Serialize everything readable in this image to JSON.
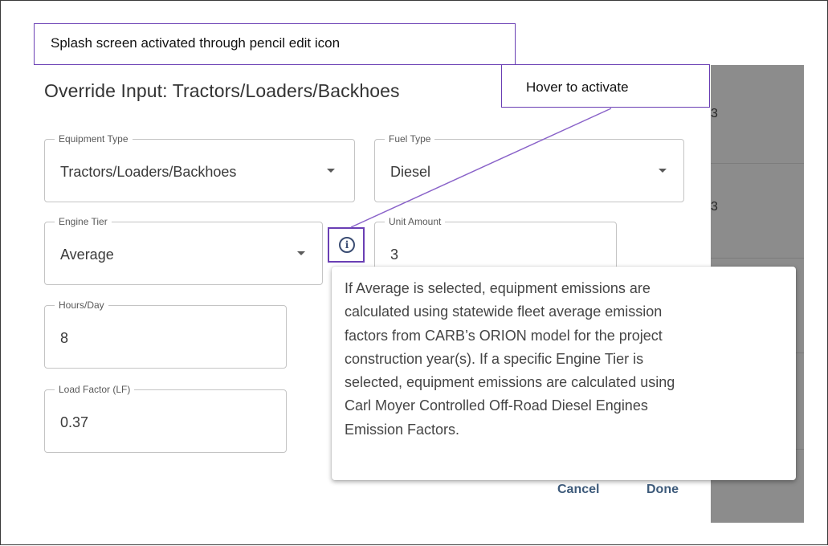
{
  "annotations": {
    "splash_note": "Splash screen activated through pencil edit icon",
    "hover_note": "Hover to activate"
  },
  "dialog": {
    "title": "Override Input: Tractors/Loaders/Backhoes",
    "fields": {
      "equipment_type": {
        "label": "Equipment Type",
        "value": "Tractors/Loaders/Backhoes"
      },
      "fuel_type": {
        "label": "Fuel Type",
        "value": "Diesel"
      },
      "engine_tier": {
        "label": "Engine Tier",
        "value": "Average"
      },
      "unit_amount": {
        "label": "Unit Amount",
        "value": "3"
      },
      "hours_per_day": {
        "label": "Hours/Day",
        "value": "8"
      },
      "load_factor": {
        "label": "Load Factor (LF)",
        "value": "0.37"
      }
    },
    "info_icon": "info-circle-icon",
    "tooltip": "If Average is selected, equipment emissions are\ncalculated using statewide fleet average emission\nfactors from CARB’s ORION model for the project\nconstruction year(s). If a specific Engine Tier is\nselected, equipment emissions are calculated using\nCarl Moyer Controlled Off-Road Diesel Engines\nEmission Factors.",
    "buttons": {
      "cancel": "Cancel",
      "done": "Done"
    }
  },
  "background": {
    "partial_values": [
      "3",
      "3"
    ]
  },
  "colors": {
    "annotation_border": "#6a3fb4",
    "button_text": "#3d5a7a",
    "backdrop": "#8c8c8c"
  }
}
